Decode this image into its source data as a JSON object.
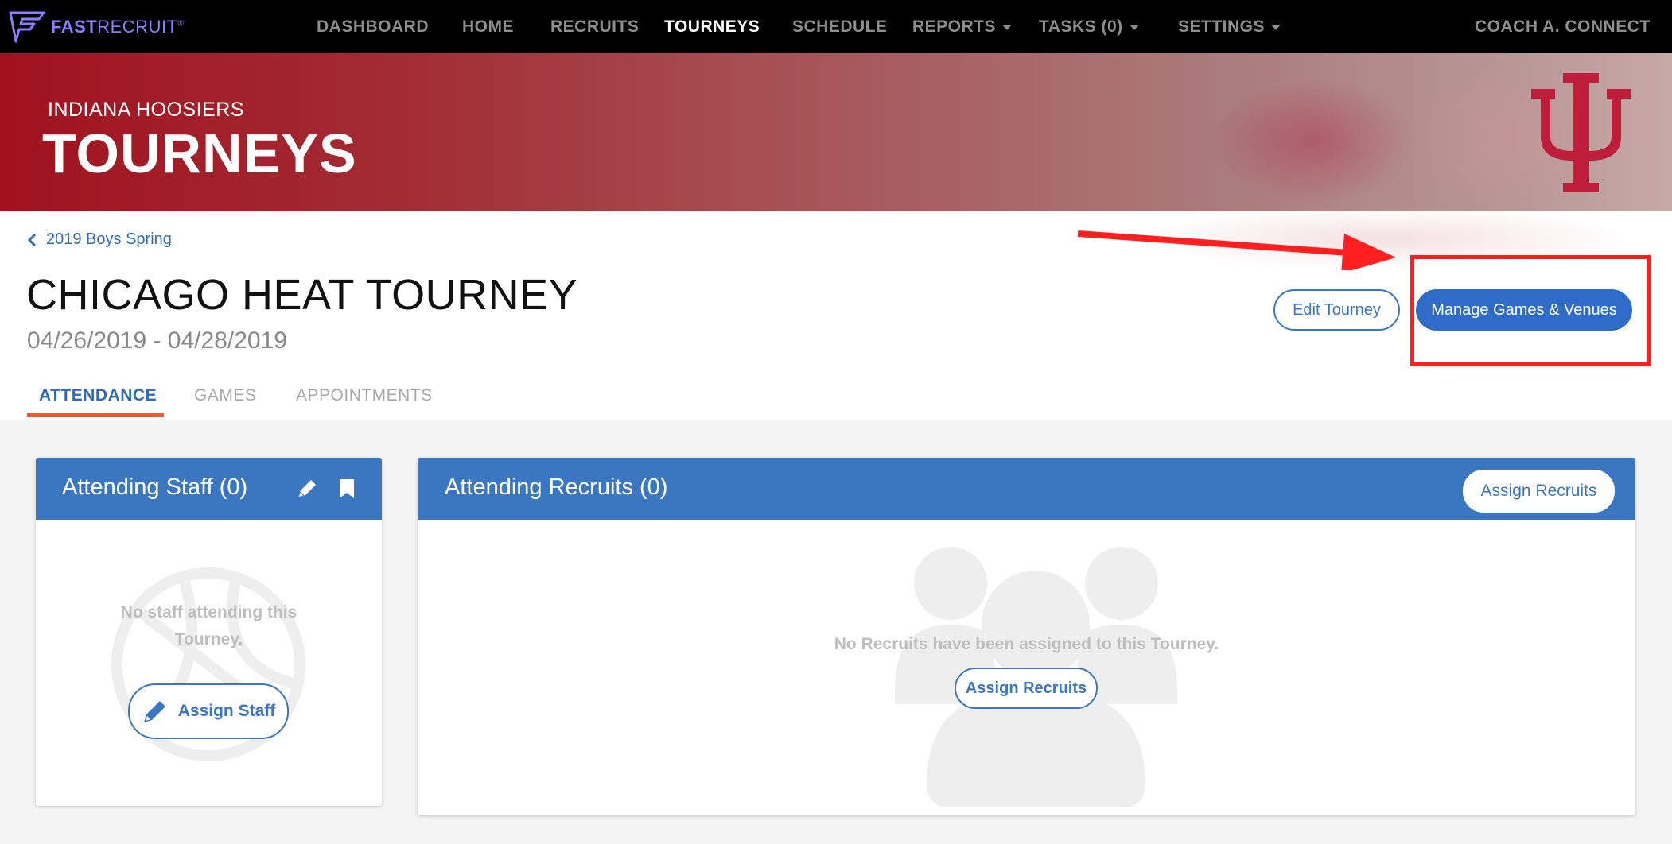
{
  "nav": {
    "logo": {
      "brand_bold": "FAST",
      "brand_rest": "RECRUIT",
      "mark": "®"
    },
    "items": [
      {
        "label": "DASHBOARD"
      },
      {
        "label": "HOME"
      },
      {
        "label": "RECRUITS"
      },
      {
        "label": "TOURNEYS",
        "active": true
      },
      {
        "label": "SCHEDULE"
      },
      {
        "label": "REPORTS"
      },
      {
        "label": "TASKS (0)"
      },
      {
        "label": "SETTINGS"
      }
    ],
    "user": "COACH A. CONNECT"
  },
  "hero": {
    "subtitle": "INDIANA HOOSIERS",
    "title": "TOURNEYS",
    "logo_color": "#be1e3a"
  },
  "breadcrumb": {
    "label": "2019 Boys Spring"
  },
  "tourney": {
    "title": "CHICAGO HEAT TOURNEY",
    "dates": "04/26/2019 - 04/28/2019"
  },
  "actions": {
    "edit_label": "Edit Tourney",
    "manage_label": "Manage Games & Venues"
  },
  "tabs": [
    {
      "label": "ATTENDANCE",
      "active": true
    },
    {
      "label": "GAMES"
    },
    {
      "label": "APPOINTMENTS"
    }
  ],
  "staff_panel": {
    "title": "Attending Staff (0)",
    "empty_text": "No staff attending this Tourney.",
    "button_label": "Assign Staff"
  },
  "recruits_panel": {
    "title": "Attending Recruits (0)",
    "header_button_label": "Assign Recruits",
    "empty_text": "No Recruits have been assigned to this Tourney.",
    "button_label": "Assign Recruits"
  },
  "colors": {
    "primary_blue": "#3b76c0",
    "accent_orange": "#ec5b2d",
    "annotation_red": "#ff1f1f",
    "hero_red": "#a0121e"
  }
}
